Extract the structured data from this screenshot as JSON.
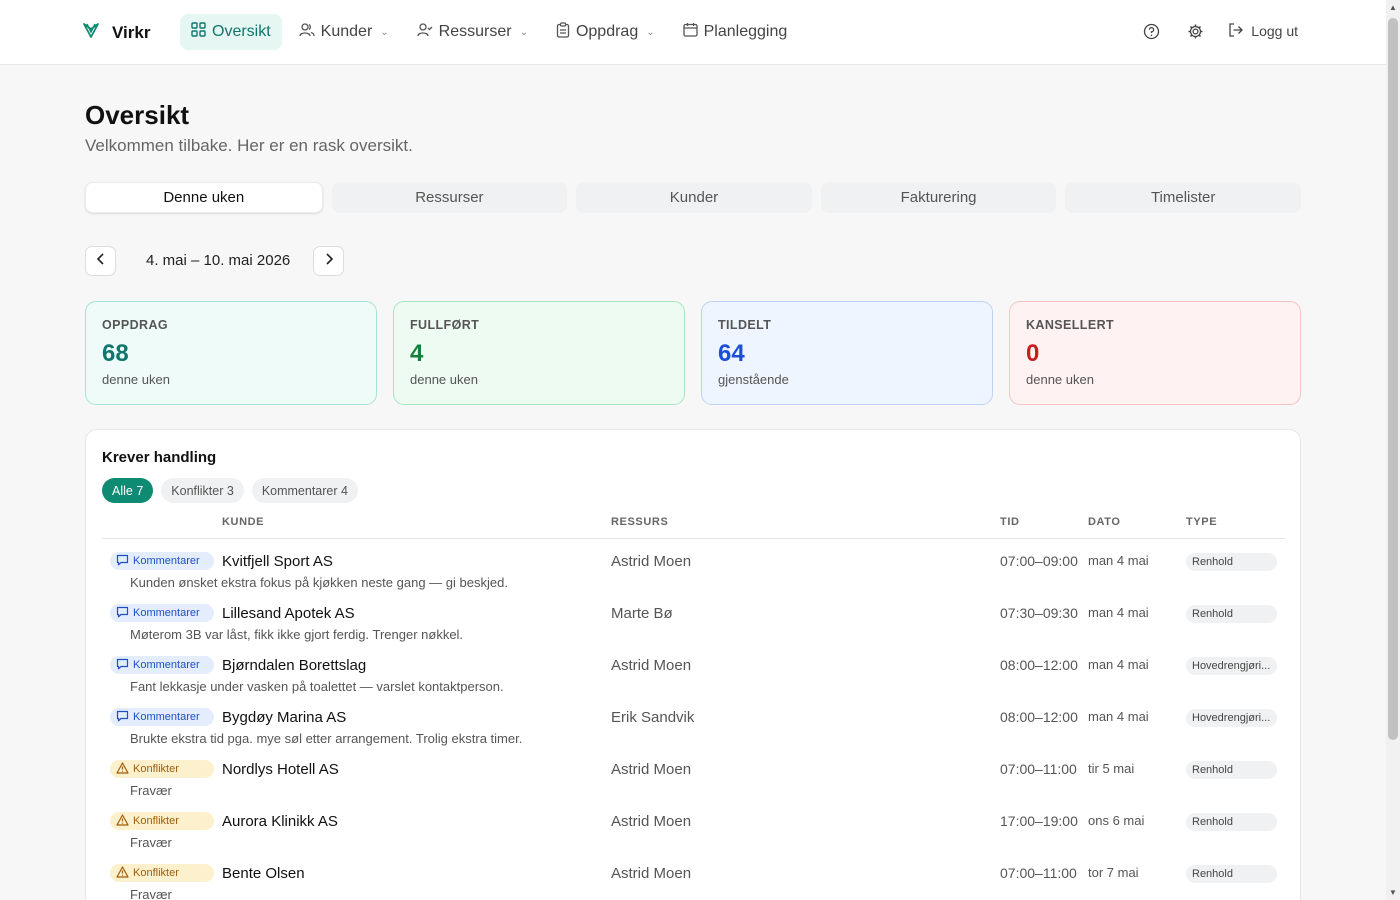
{
  "nav": {
    "brand": "Virkr",
    "items": [
      {
        "label": "Oversikt",
        "icon": "grid-icon",
        "active": true,
        "dropdown": false
      },
      {
        "label": "Kunder",
        "icon": "users-icon",
        "active": false,
        "dropdown": true
      },
      {
        "label": "Ressurser",
        "icon": "user-check-icon",
        "active": false,
        "dropdown": true
      },
      {
        "label": "Oppdrag",
        "icon": "clipboard-icon",
        "active": false,
        "dropdown": true
      },
      {
        "label": "Planlegging",
        "icon": "calendar-icon",
        "active": false,
        "dropdown": false
      }
    ],
    "logout": "Logg ut"
  },
  "header": {
    "title": "Oversikt",
    "subtitle": "Velkommen tilbake. Her er en rask oversikt."
  },
  "tabs": [
    "Denne uken",
    "Ressurser",
    "Kunder",
    "Fakturering",
    "Timelister"
  ],
  "week": {
    "label": "4. mai – 10. mai 2026"
  },
  "cards": [
    {
      "label": "OPPDRAG",
      "value": "68",
      "desc": "denne uken"
    },
    {
      "label": "FULLFØRT",
      "value": "4",
      "desc": "denne uken"
    },
    {
      "label": "TILDELT",
      "value": "64",
      "desc": "gjenstående"
    },
    {
      "label": "KANSELLERT",
      "value": "0",
      "desc": "denne uken"
    }
  ],
  "actions": {
    "title": "Krever handling",
    "filters": [
      "Alle 7",
      "Konflikter 3",
      "Kommentarer 4"
    ],
    "columns": [
      "KUNDE",
      "RESSURS",
      "TID",
      "DATO",
      "TYPE"
    ],
    "rows": [
      {
        "badge": "Kommentarer",
        "kind": "kom",
        "kunde": "Kvitfjell Sport AS",
        "note": "Kunden ønsket ekstra fokus på kjøkken neste gang — gi beskjed.",
        "ressurs": "Astrid Moen",
        "tid": "07:00–09:00",
        "dato": "man 4 mai",
        "type": "Renhold"
      },
      {
        "badge": "Kommentarer",
        "kind": "kom",
        "kunde": "Lillesand Apotek AS",
        "note": "Møterom 3B var låst, fikk ikke gjort ferdig. Trenger nøkkel.",
        "ressurs": "Marte Bø",
        "tid": "07:30–09:30",
        "dato": "man 4 mai",
        "type": "Renhold"
      },
      {
        "badge": "Kommentarer",
        "kind": "kom",
        "kunde": "Bjørndalen Borettslag",
        "note": "Fant lekkasje under vasken på toalettet — varslet kontaktperson.",
        "ressurs": "Astrid Moen",
        "tid": "08:00–12:00",
        "dato": "man 4 mai",
        "type": "Hovedrengjøri..."
      },
      {
        "badge": "Kommentarer",
        "kind": "kom",
        "kunde": "Bygdøy Marina AS",
        "note": "Brukte ekstra tid pga. mye søl etter arrangement. Trolig ekstra timer.",
        "ressurs": "Erik Sandvik",
        "tid": "08:00–12:00",
        "dato": "man 4 mai",
        "type": "Hovedrengjøri..."
      },
      {
        "badge": "Konflikter",
        "kind": "kon",
        "kunde": "Nordlys Hotell AS",
        "note": "Fravær",
        "ressurs": "Astrid Moen",
        "tid": "07:00–11:00",
        "dato": "tir 5 mai",
        "type": "Renhold"
      },
      {
        "badge": "Konflikter",
        "kind": "kon",
        "kunde": "Aurora Klinikk AS",
        "note": "Fravær",
        "ressurs": "Astrid Moen",
        "tid": "17:00–19:00",
        "dato": "ons 6 mai",
        "type": "Renhold"
      },
      {
        "badge": "Konflikter",
        "kind": "kon",
        "kunde": "Bente Olsen",
        "note": "Fravær",
        "ressurs": "Astrid Moen",
        "tid": "07:00–11:00",
        "dato": "tor 7 mai",
        "type": "Renhold"
      }
    ]
  }
}
